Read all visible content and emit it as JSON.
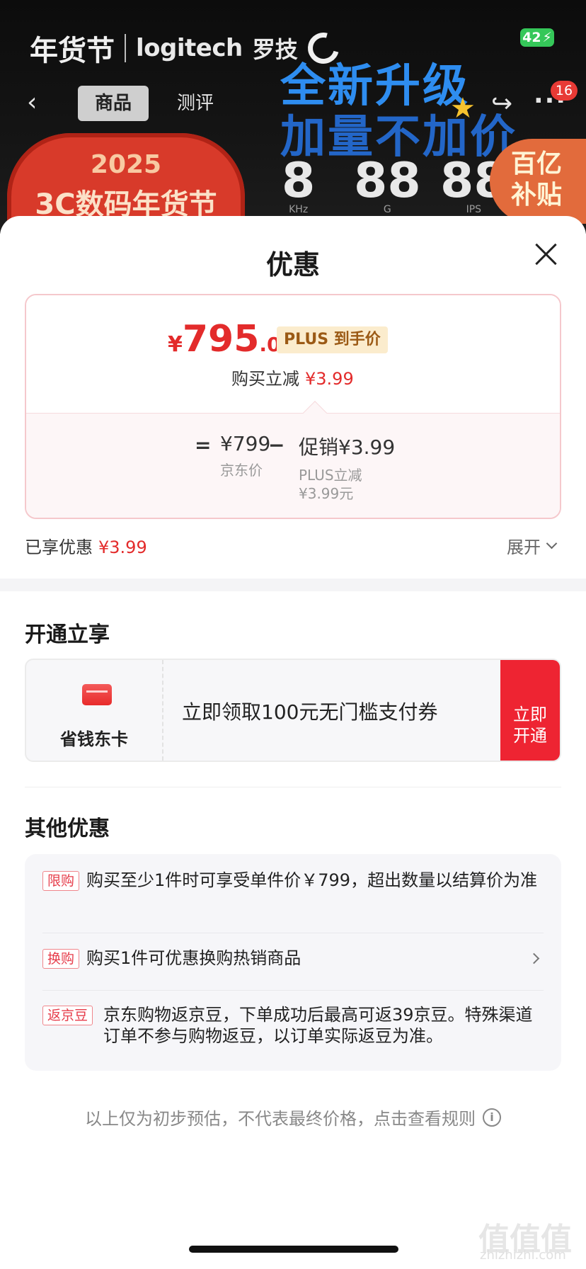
{
  "status_bar": {
    "battery": "42"
  },
  "hero": {
    "festival_logo": "年货节",
    "brand": "logitech",
    "brand_cn": "罗技",
    "nav_tabs": [
      "商品",
      "测评"
    ],
    "cart_badge": "16",
    "headline_line1": "全新升级",
    "headline_line2": "加量不加价",
    "event_year": "2025",
    "event_name": "3C数码年货节",
    "specs": [
      {
        "value": "8",
        "unit": "KHz"
      },
      {
        "value": "88",
        "unit": "G"
      },
      {
        "value": "88",
        "unit": "IPS"
      }
    ],
    "subsidy_line1": "百亿",
    "subsidy_line2": "补贴"
  },
  "sheet": {
    "title": "优惠",
    "price_card": {
      "currency": "¥",
      "price_int": "795",
      "price_dec": ".01",
      "price_tag": "PLUS 到手价",
      "reduce_label": "购买立减",
      "reduce_amount": "¥3.99",
      "calc": {
        "equals": "=",
        "minus": "−",
        "base_value": "¥799",
        "base_label": "京东价",
        "promo_value": "促销¥3.99",
        "promo_label_line1": "PLUS立减",
        "promo_label_line2": "¥3.99元"
      }
    },
    "enjoyed_label": "已享优惠",
    "enjoyed_amount": "¥3.99",
    "expand_label": "展开",
    "open_section_title": "开通立享",
    "card_offer": {
      "card_name": "省钱东卡",
      "description": "立即领取100元无门槛支付券",
      "button_line1": "立即",
      "button_line2": "开通"
    },
    "other_section_title": "其他优惠",
    "other_items": [
      {
        "tag": "限购",
        "text": "购买至少1件时可享受单件价￥799，超出数量以结算价为准"
      },
      {
        "tag": "换购",
        "text": "购买1件可优惠换购热销商品"
      },
      {
        "tag": "返京豆",
        "text": "京东购物返京豆，下单成功后最高可返39京豆。特殊渠道订单不参与购物返豆，以订单实际返豆为准。"
      }
    ],
    "footnote": "以上仅为初步预估，不代表最终价格，点击查看规则"
  },
  "watermark": {
    "text": "值值值",
    "url": "zhizhizhi.com"
  },
  "colors": {
    "accent_red": "#e32b2b",
    "button_red": "#ee2432",
    "plus_gold": "#9b5a15"
  }
}
